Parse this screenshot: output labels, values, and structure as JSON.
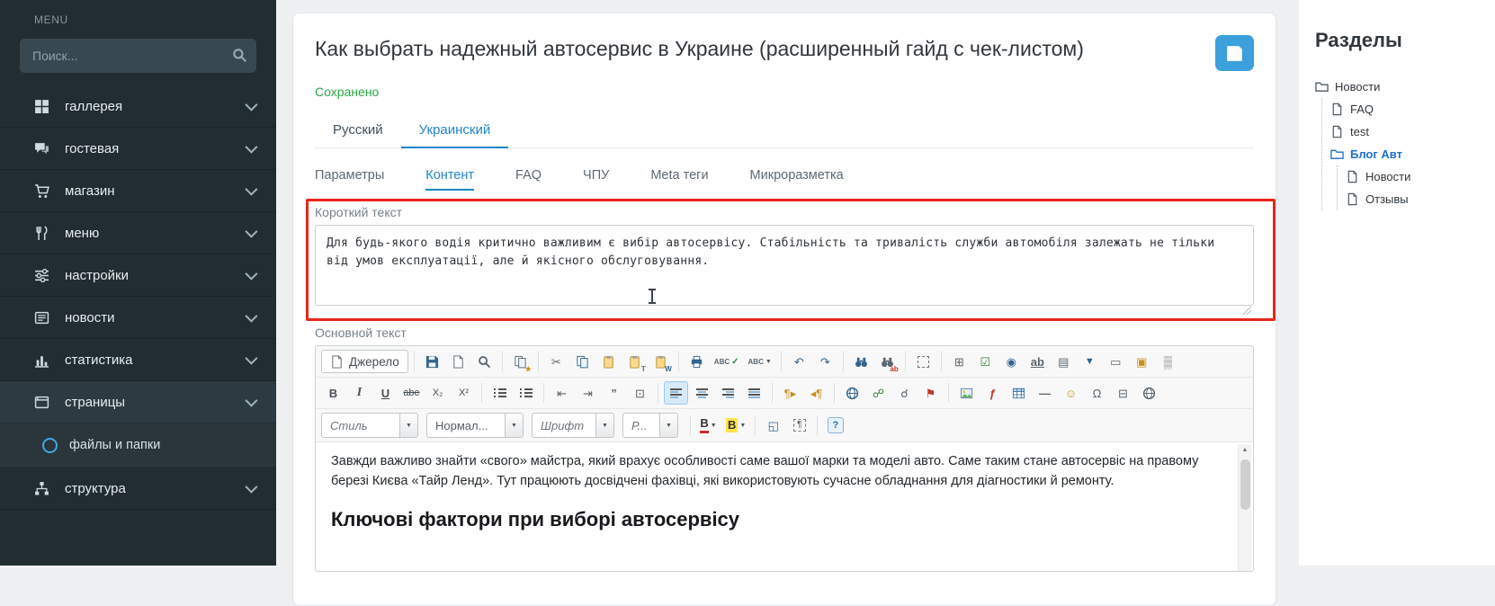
{
  "sidebar": {
    "menu_label": "MENU",
    "search_placeholder": "Поиск...",
    "items": [
      {
        "label": "галлерея"
      },
      {
        "label": "гостевая"
      },
      {
        "label": "магазин"
      },
      {
        "label": "меню"
      },
      {
        "label": "настройки"
      },
      {
        "label": "новости"
      },
      {
        "label": "статистика"
      },
      {
        "label": "страницы"
      },
      {
        "label": "структура"
      }
    ],
    "subitem_label": "файлы и папки"
  },
  "header": {
    "title": "Как выбрать надежный автосервис в Украине (расширенный гайд с чек-листом)",
    "status": "Сохранено"
  },
  "language_tabs": [
    {
      "label": "Русский"
    },
    {
      "label": "Украинский"
    }
  ],
  "content_tabs": [
    {
      "label": "Параметры"
    },
    {
      "label": "Контент"
    },
    {
      "label": "FAQ"
    },
    {
      "label": "ЧПУ"
    },
    {
      "label": "Meta теги"
    },
    {
      "label": "Микроразметка"
    }
  ],
  "short_text": {
    "label": "Короткий текст",
    "value": "Для будь-якого водія критично важливим є вибір автосервісу. Стабільність та тривалість служби автомобіля залежать не тільки від умов експлуатації, але й якісного обслуговування."
  },
  "editor": {
    "label": "Основной текст",
    "source_label": "Джерело",
    "dropdowns": {
      "style": "Стиль",
      "format": "Нормал...",
      "font": "Шрифт",
      "size": "Р..."
    },
    "glyphs": {
      "caret": "▼",
      "star": "★",
      "cut": "✂",
      "pasteT": "T",
      "pasteW": "W",
      "spell": "ABC",
      "check": "✓",
      "undo": "↶",
      "redo": "↷",
      "form": "⊞",
      "checkbox": "☑",
      "radio": "◉",
      "textfield": "ab",
      "textareaIco": "▤",
      "selectfield": "▼",
      "buttonfield": "▭",
      "imagebutton": "▣",
      "hiddenfield": "▒",
      "bold": "B",
      "italic": "I",
      "underline": "U",
      "strike": "abe",
      "sub": "X₂",
      "sup": "X²",
      "outdent": "⇤",
      "indent": "⇥",
      "blockquote": "”",
      "creatediv": "⊡",
      "ltr": "¶▸",
      "rtl": "◂¶",
      "link": "☍",
      "unlink": "☌",
      "anchor": "⚑",
      "flash": "ƒ",
      "hr": "—",
      "smiley": "☺",
      "specialchar": "Ω",
      "pagebreak": "⊟",
      "maximize": "◱",
      "showblocks": "¶",
      "about": "?",
      "sb_up": "▲"
    },
    "content": {
      "paragraph": "Завжди важливо знайти «свого» майстра, який врахує особливості саме вашої марки та моделі авто. Саме таким стане автосервіс на правому березі Києва «Тайр Ленд». Тут працюють досвідчені фахівці, які використовують сучасне обладнання для діагностики й ремонту.",
      "heading": "Ключові фактори при виборі автосервісу"
    }
  },
  "sections": {
    "title": "Разделы",
    "items": [
      {
        "label": "Новости"
      },
      {
        "label": "FAQ"
      },
      {
        "label": "test"
      },
      {
        "label": "Блог Авт"
      },
      {
        "label": "Новости"
      },
      {
        "label": "Отзывы"
      }
    ]
  },
  "colors": {
    "accent_blue": "#2086c8",
    "save_button_blue": "#3ba0dc",
    "saved_green": "#27a844",
    "annotation_red": "#e8261d",
    "sidebar_bg": "#222d32"
  }
}
